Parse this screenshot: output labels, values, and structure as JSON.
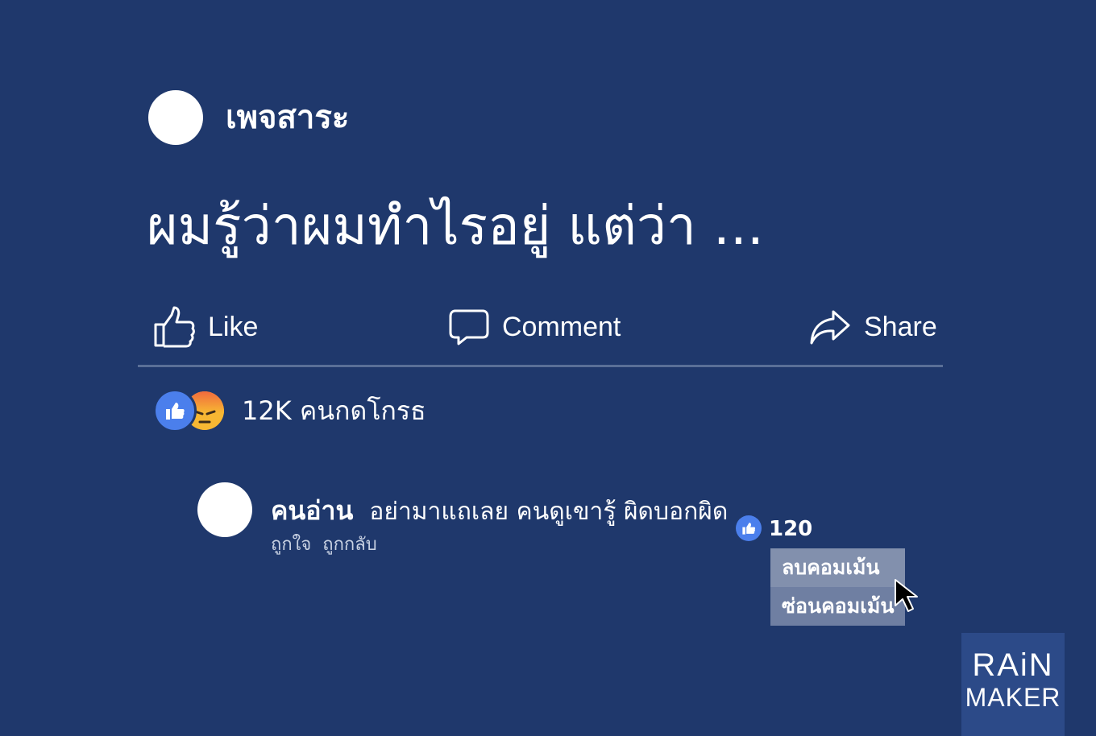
{
  "post": {
    "page_name": "เพจสาระ",
    "text": "ผมรู้ว่าผมทำไรอยู่ แต่ว่า ...",
    "actions": {
      "like": "Like",
      "comment": "Comment",
      "share": "Share"
    },
    "reactions": {
      "summary": "12K คนกดโกรธ",
      "icons": [
        "like-reaction-icon",
        "angry-reaction-icon"
      ]
    }
  },
  "comment": {
    "author": "คนอ่าน",
    "text": "อย่ามาแถเลย คนดูเขารู้ ผิดบอกผิด",
    "actions": [
      "ถูกใจ",
      "ถูกกลับ"
    ],
    "like_count": "120"
  },
  "context_menu": {
    "items": [
      {
        "label": "ลบคอมเม้น"
      },
      {
        "label": "ซ่อนคอมเม้น"
      }
    ]
  },
  "brand": {
    "line1": "RAiN",
    "line2": "MAKER"
  },
  "colors": {
    "background": "#1f386c",
    "like_blue": "#4b7fec",
    "angry_orange": "#f5a623",
    "menu_bg": "#8290ad"
  }
}
